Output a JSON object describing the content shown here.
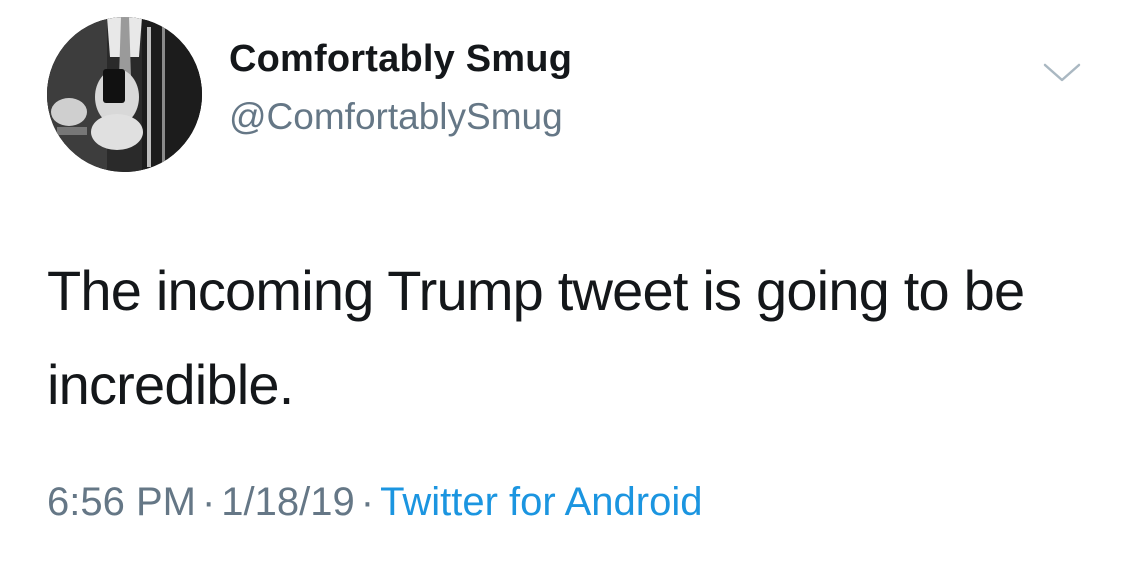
{
  "tweet": {
    "author": {
      "display_name": "Comfortably Smug",
      "handle": "@ComfortablySmug",
      "avatar_icon": "user-avatar-photo"
    },
    "text": "The incoming Trump tweet is going to be incredible.",
    "time": "6:56 PM",
    "date": "1/18/19",
    "separator": "·",
    "source": "Twitter for Android",
    "menu_icon": "chevron-down-icon"
  },
  "colors": {
    "text": "#14171a",
    "secondary": "#657786",
    "link": "#1b95e0",
    "caret": "#aab8c2"
  }
}
